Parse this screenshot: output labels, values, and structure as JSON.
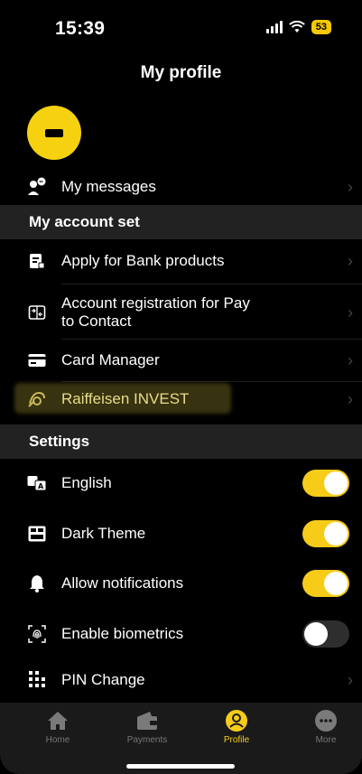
{
  "status": {
    "time": "15:39",
    "battery": "53"
  },
  "header": {
    "title": "My profile"
  },
  "menu": {
    "messages": "My messages",
    "section_account": "My account set",
    "apply": "Apply for Bank products",
    "registration_line1": "Account registration for Pay",
    "registration_line2": "to Contact",
    "card_manager": "Card Manager",
    "invest": "Raiffeisen INVEST"
  },
  "settings": {
    "section_title": "Settings",
    "english": {
      "label": "English",
      "on": true
    },
    "dark_theme": {
      "label": "Dark Theme",
      "on": true
    },
    "notifications": {
      "label": "Allow notifications",
      "on": true
    },
    "biometrics": {
      "label": "Enable biometrics",
      "on": false
    },
    "pin": "PIN Change"
  },
  "tabs": [
    {
      "label": "Home",
      "icon": "home-icon"
    },
    {
      "label": "Payments",
      "icon": "wallet-icon"
    },
    {
      "label": "Profile",
      "icon": "profile-icon",
      "active": true
    },
    {
      "label": "More",
      "icon": "more-icon"
    }
  ],
  "colors": {
    "accent": "#f6cc19",
    "highlight": "#d4c445",
    "background": "#000000",
    "section_bg": "#222222"
  }
}
